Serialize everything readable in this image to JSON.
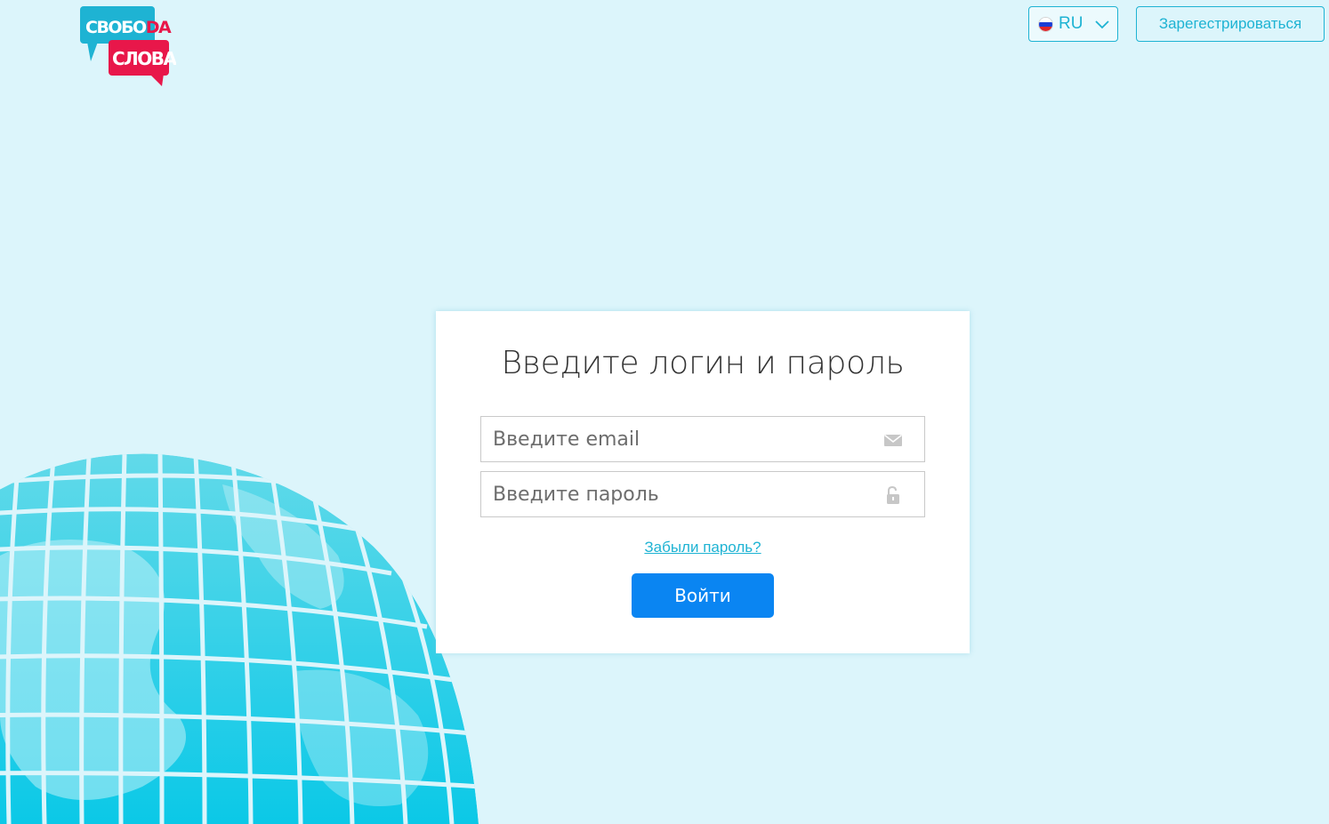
{
  "logo": {
    "line1_main": "СВОБО",
    "line1_accent": "DA",
    "line2": "СЛОВА"
  },
  "header": {
    "language_code": "RU",
    "register_label": "Зарегестрироваться"
  },
  "login": {
    "title": "Введите логин и пароль",
    "email_placeholder": "Введите email",
    "password_placeholder": "Введите пароль",
    "forgot_label": "Забыли пароль?",
    "submit_label": "Войти"
  },
  "icons": {
    "email_field": "envelope-icon",
    "password_field": "lock-icon",
    "language_flag": "russia-flag-icon",
    "language_dropdown": "chevron-down-icon"
  },
  "colors": {
    "background": "#dcf5fb",
    "accent": "#1eb3d3",
    "primary_button": "#0a85f2",
    "logo_blue": "#1eb3d3",
    "logo_red": "#e8174a"
  }
}
